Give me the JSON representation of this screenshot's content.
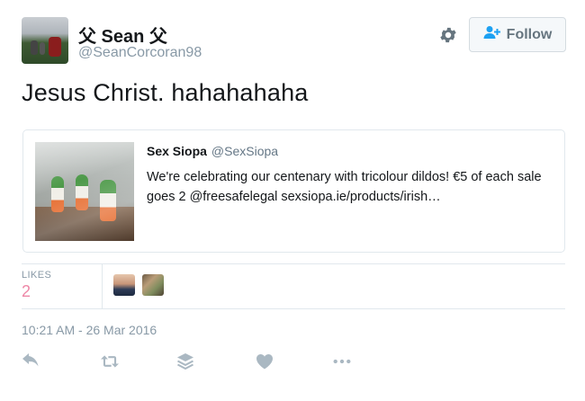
{
  "user": {
    "display_name": "父 Sean 父",
    "handle": "@SeanCorcoran98"
  },
  "follow_button": {
    "label": "Follow"
  },
  "tweet": {
    "text": "Jesus Christ. hahahahaha",
    "timestamp": "10:21 AM - 26 Mar 2016"
  },
  "quoted_tweet": {
    "name": "Sex Siopa",
    "handle": "@SexSiopa",
    "text": "We're celebrating our centenary with tricolour dildos! €5 of each sale goes 2 @freesafelegal sexsiopa.ie/products/irish…"
  },
  "stats": {
    "likes_label": "LIKES",
    "likes_count": "2"
  },
  "icons": [
    "gear-icon",
    "follow-person-icon",
    "reply-icon",
    "retweet-icon",
    "layers-icon",
    "heart-icon",
    "more-icon"
  ],
  "colors": {
    "text": "#14171a",
    "muted": "#8899a6",
    "like": "#e0245e",
    "border": "#e1e8ed",
    "button_bg": "#f5f8fa"
  }
}
